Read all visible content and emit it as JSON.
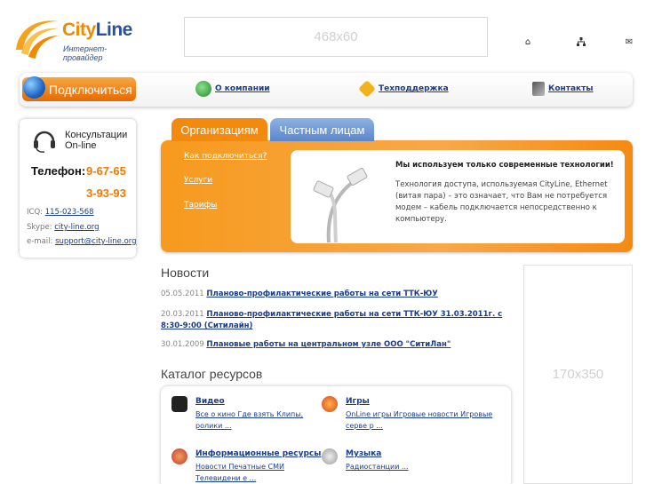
{
  "header": {
    "logo_name_1": "City",
    "logo_name_2": "Line",
    "logo_sub": "Интернет-провайдер",
    "banner_top": "468x60",
    "icons": [
      "home-icon",
      "sitemap-icon",
      "mail-icon"
    ]
  },
  "nav": {
    "connect": "Подключиться",
    "about": "О компании",
    "support": "Техподдержка",
    "contacts": "Контакты"
  },
  "contact": {
    "consult_line1": "Консультации",
    "consult_line2": "On-line",
    "phone_label": "Телефон:",
    "phone1": "9-67-65",
    "phone2": "3-93-93",
    "icq_label": "ICQ:",
    "icq": "115-023-568",
    "skype_label": "Skype:",
    "skype": "city-line.org",
    "email_label": "e-mail:",
    "email": "support@city-line.org"
  },
  "tabs": {
    "org": "Организациям",
    "private": "Частным лицам"
  },
  "panel": {
    "links": [
      "Как подключиться?",
      "Услуги",
      "Тарифы"
    ],
    "info_title": "Мы используем только современные технологии!",
    "info_text": "Технология доступа, используемая CityLine, Ethernet (витая пара) – это означает, что Вам не потребуется модем – кабель подключается непосредственно к компьютеру."
  },
  "banner_right": "170x350",
  "news": {
    "title": "Новости",
    "items": [
      {
        "date": "05.05.2011",
        "text": "Планово-профилактические работы на сети ТТК-ЮУ"
      },
      {
        "date": "20.03.2011",
        "text": "Планово-профилактические работы на сети ТТК-ЮУ 31.03.2011г. с 8:30-9:00 (Ситилайн)"
      },
      {
        "date": "30.01.2009",
        "text": "Плановые работы на центральном узле ООО \"СитиЛан\""
      }
    ]
  },
  "catalog": {
    "title": "Каталог ресурсов",
    "items": [
      {
        "name": "Видео",
        "links": "Все о кино  Где взять  Клипы, ролики  ..."
      },
      {
        "name": "Игры",
        "links": "OnLine игры  Игровые новости  Игровые серве р  ..."
      },
      {
        "name": "Информационные ресурсы",
        "links": "Новости  Печатные СМИ  Телевидени е  ..."
      },
      {
        "name": "Музыка",
        "links": "Радиостанции  ..."
      }
    ]
  }
}
